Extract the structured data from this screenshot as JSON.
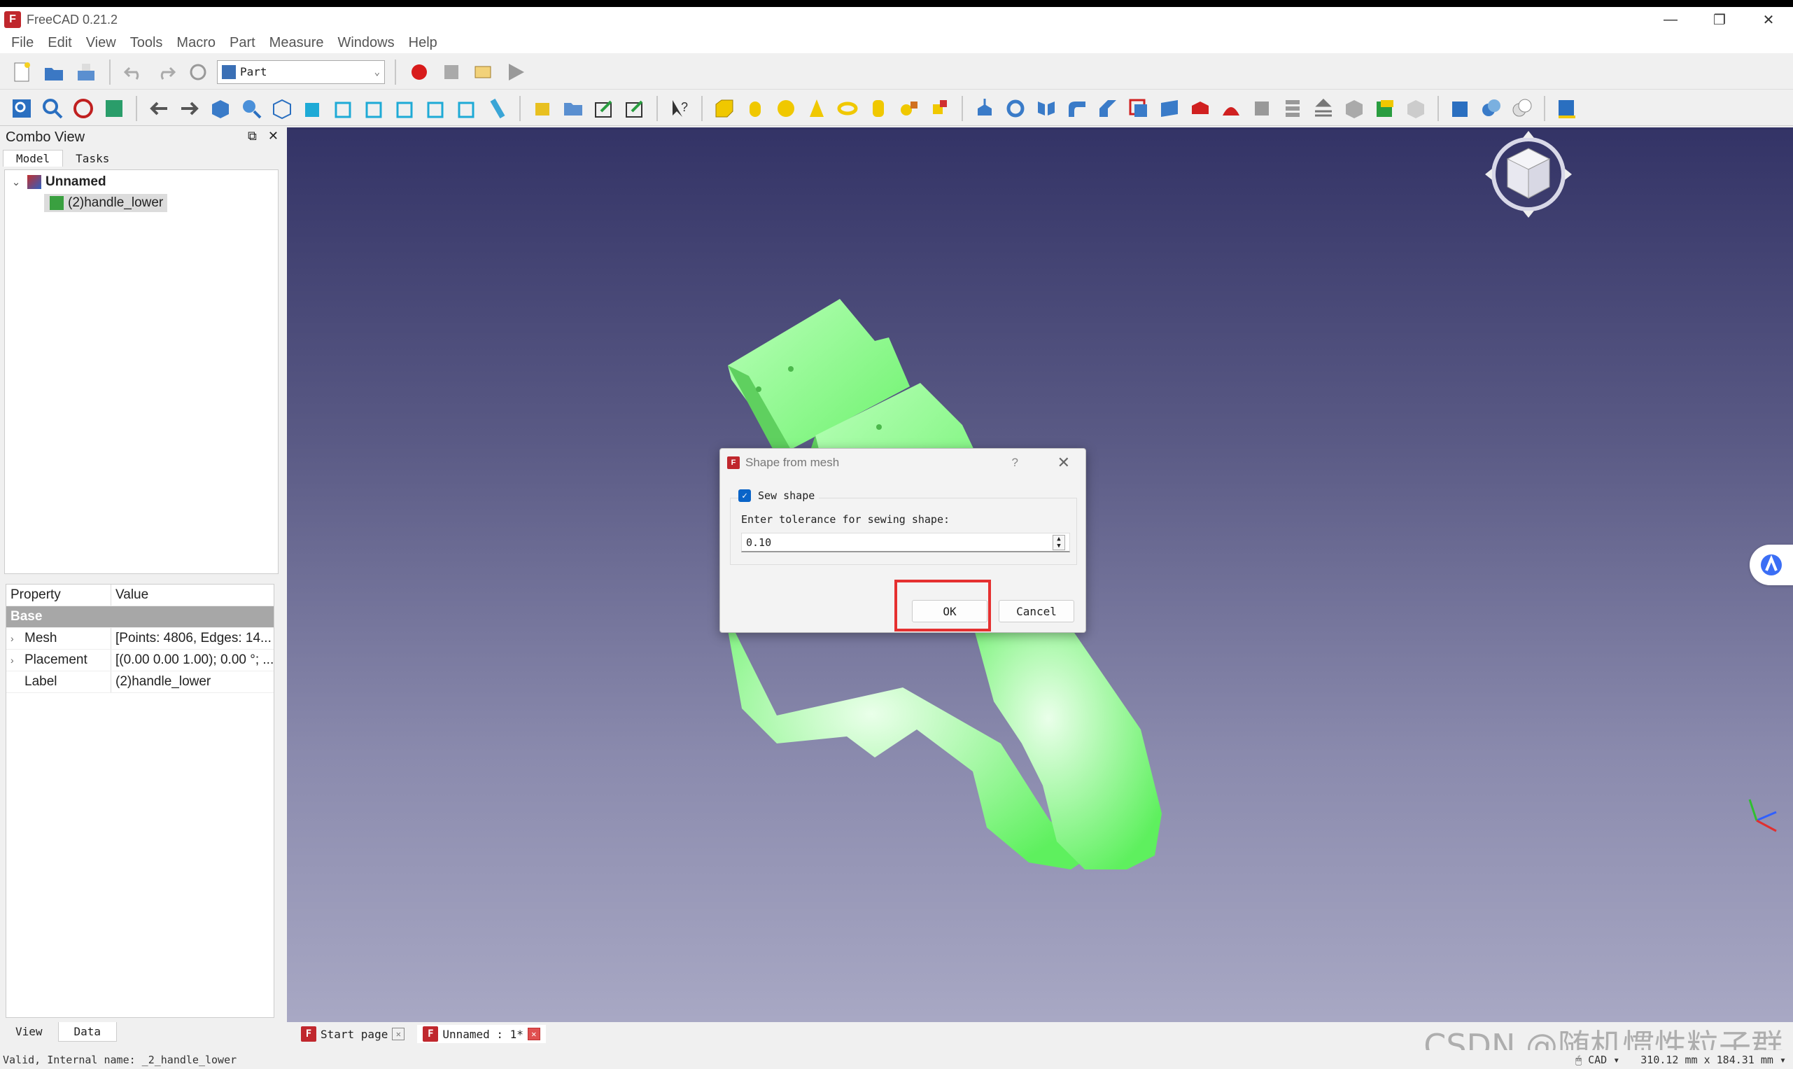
{
  "window": {
    "title": "FreeCAD 0.21.2",
    "controls": [
      "—",
      "❐",
      "✕"
    ]
  },
  "menu": [
    "File",
    "Edit",
    "View",
    "Tools",
    "Macro",
    "Part",
    "Measure",
    "Windows",
    "Help"
  ],
  "toolbar": {
    "workbench": "Part"
  },
  "combo": {
    "title": "Combo View",
    "tabs": [
      "Model",
      "Tasks"
    ],
    "tree": {
      "document": "Unnamed",
      "object": "(2)handle_lower"
    },
    "props": {
      "headers": [
        "Property",
        "Value"
      ],
      "group": "Base",
      "rows": [
        {
          "name": "Mesh",
          "value": "[Points: 4806, Edges: 14..."
        },
        {
          "name": "Placement",
          "value": "[(0.00 0.00 1.00); 0.00 °; ..."
        },
        {
          "name": "Label",
          "value": "(2)handle_lower"
        }
      ]
    },
    "bottom_tabs": [
      "View",
      "Data"
    ]
  },
  "dialog": {
    "title": "Shape from mesh",
    "help": "?",
    "checkbox_label": "Sew shape",
    "checked": true,
    "tolerance_label": "Enter tolerance for sewing shape:",
    "tolerance_value": "0.10",
    "ok": "OK",
    "cancel": "Cancel"
  },
  "doc_tabs": [
    "Start page",
    "Unnamed : 1*"
  ],
  "statusbar": {
    "message": "Valid, Internal name: _2_handle_lower",
    "nav": "CAD",
    "dims": "310.12 mm x 184.31 mm"
  },
  "watermark": "CSDN @随机惯性粒子群",
  "colors": {
    "accent": "#0a64c8",
    "highlight": "#e53030",
    "model": "#66ff66"
  }
}
